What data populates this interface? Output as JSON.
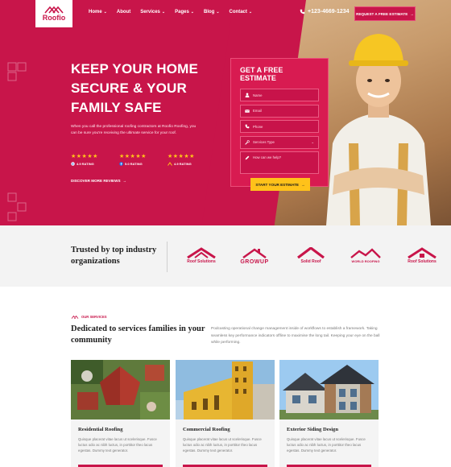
{
  "brand": {
    "name": "Roofio",
    "accent": "#c8154a",
    "star_color": "#ffc21a"
  },
  "nav": {
    "items": [
      {
        "label": "Home",
        "has_caret": true
      },
      {
        "label": "About",
        "has_caret": false
      },
      {
        "label": "Services",
        "has_caret": true
      },
      {
        "label": "Pages",
        "has_caret": true
      },
      {
        "label": "Blog",
        "has_caret": true
      },
      {
        "label": "Contact",
        "has_caret": true
      }
    ],
    "caret_glyph": "⌄",
    "phone": "+123-4669-1234",
    "cta_label": "REQUEST A FREE ESTIMATE",
    "cta_arrow": "→"
  },
  "hero": {
    "title": "KEEP YOUR HOME SECURE & YOUR FAMILY SAFE",
    "description": "When you call the professional roofing contractors at Roofio Roofing, you can be sure you're receiving the ultimate service for your roof.",
    "ratings": [
      {
        "stars": "★★★★★",
        "label": "4.9 RATING",
        "icon": "google-icon"
      },
      {
        "stars": "★★★★★",
        "label": "5.0 RATING",
        "icon": "facebook-icon"
      },
      {
        "stars": "★★★★★",
        "label": "4.9 RATING",
        "icon": "roof-review-icon"
      }
    ],
    "discover_label": "DISCOVER MORE REVIEWS",
    "discover_arrow": "→"
  },
  "estimate_form": {
    "title": "GET A FREE ESTIMATE",
    "fields": [
      {
        "icon": "user-icon",
        "placeholder": "Name"
      },
      {
        "icon": "mail-icon",
        "placeholder": "Email"
      },
      {
        "icon": "phone-icon",
        "placeholder": "Phone"
      },
      {
        "icon": "tools-icon",
        "placeholder": "Services Type",
        "has_caret": true
      }
    ],
    "message_placeholder": "How can we help?",
    "submit_label": "START YOUR ESTIMATE",
    "submit_arrow": "→"
  },
  "trust": {
    "title": "Trusted by top industry organizations",
    "partners": [
      {
        "name": "Roof Solutions"
      },
      {
        "name": "GROWUP"
      },
      {
        "name": "Solid Roof"
      },
      {
        "name": "WORLD ROOFING"
      },
      {
        "name": "Roof Solutions"
      }
    ]
  },
  "services": {
    "kicker": "OUR SERVICES",
    "title": "Dedicated to services families in your community",
    "description": "Podcasting operational change management inside of workflows to establish a framework. Taking seamless key performance indicators offline to maximise the long tail. Keeping your eye on the ball while performing.",
    "cards": [
      {
        "title": "Residential Roofing",
        "description": "Quisque placerat vitae lacus ut scelerisque. Fusce luctus odio ac nibh luctus, in porttitor theo lacus egestas. Dummy text generator."
      },
      {
        "title": "Commercial Roofing",
        "description": "Quisque placerat vitae lacus ut scelerisque. Fusce luctus odio ac nibh luctus, in porttitor theo lacus egestas. Dummy text generator."
      },
      {
        "title": "Exterior Siding Design",
        "description": "Quisque placerat vitae lacus ut scelerisque. Fusce luctus odio ac nibh luctus, in porttitor theo lacus egestas. Dummy text generator."
      }
    ]
  }
}
